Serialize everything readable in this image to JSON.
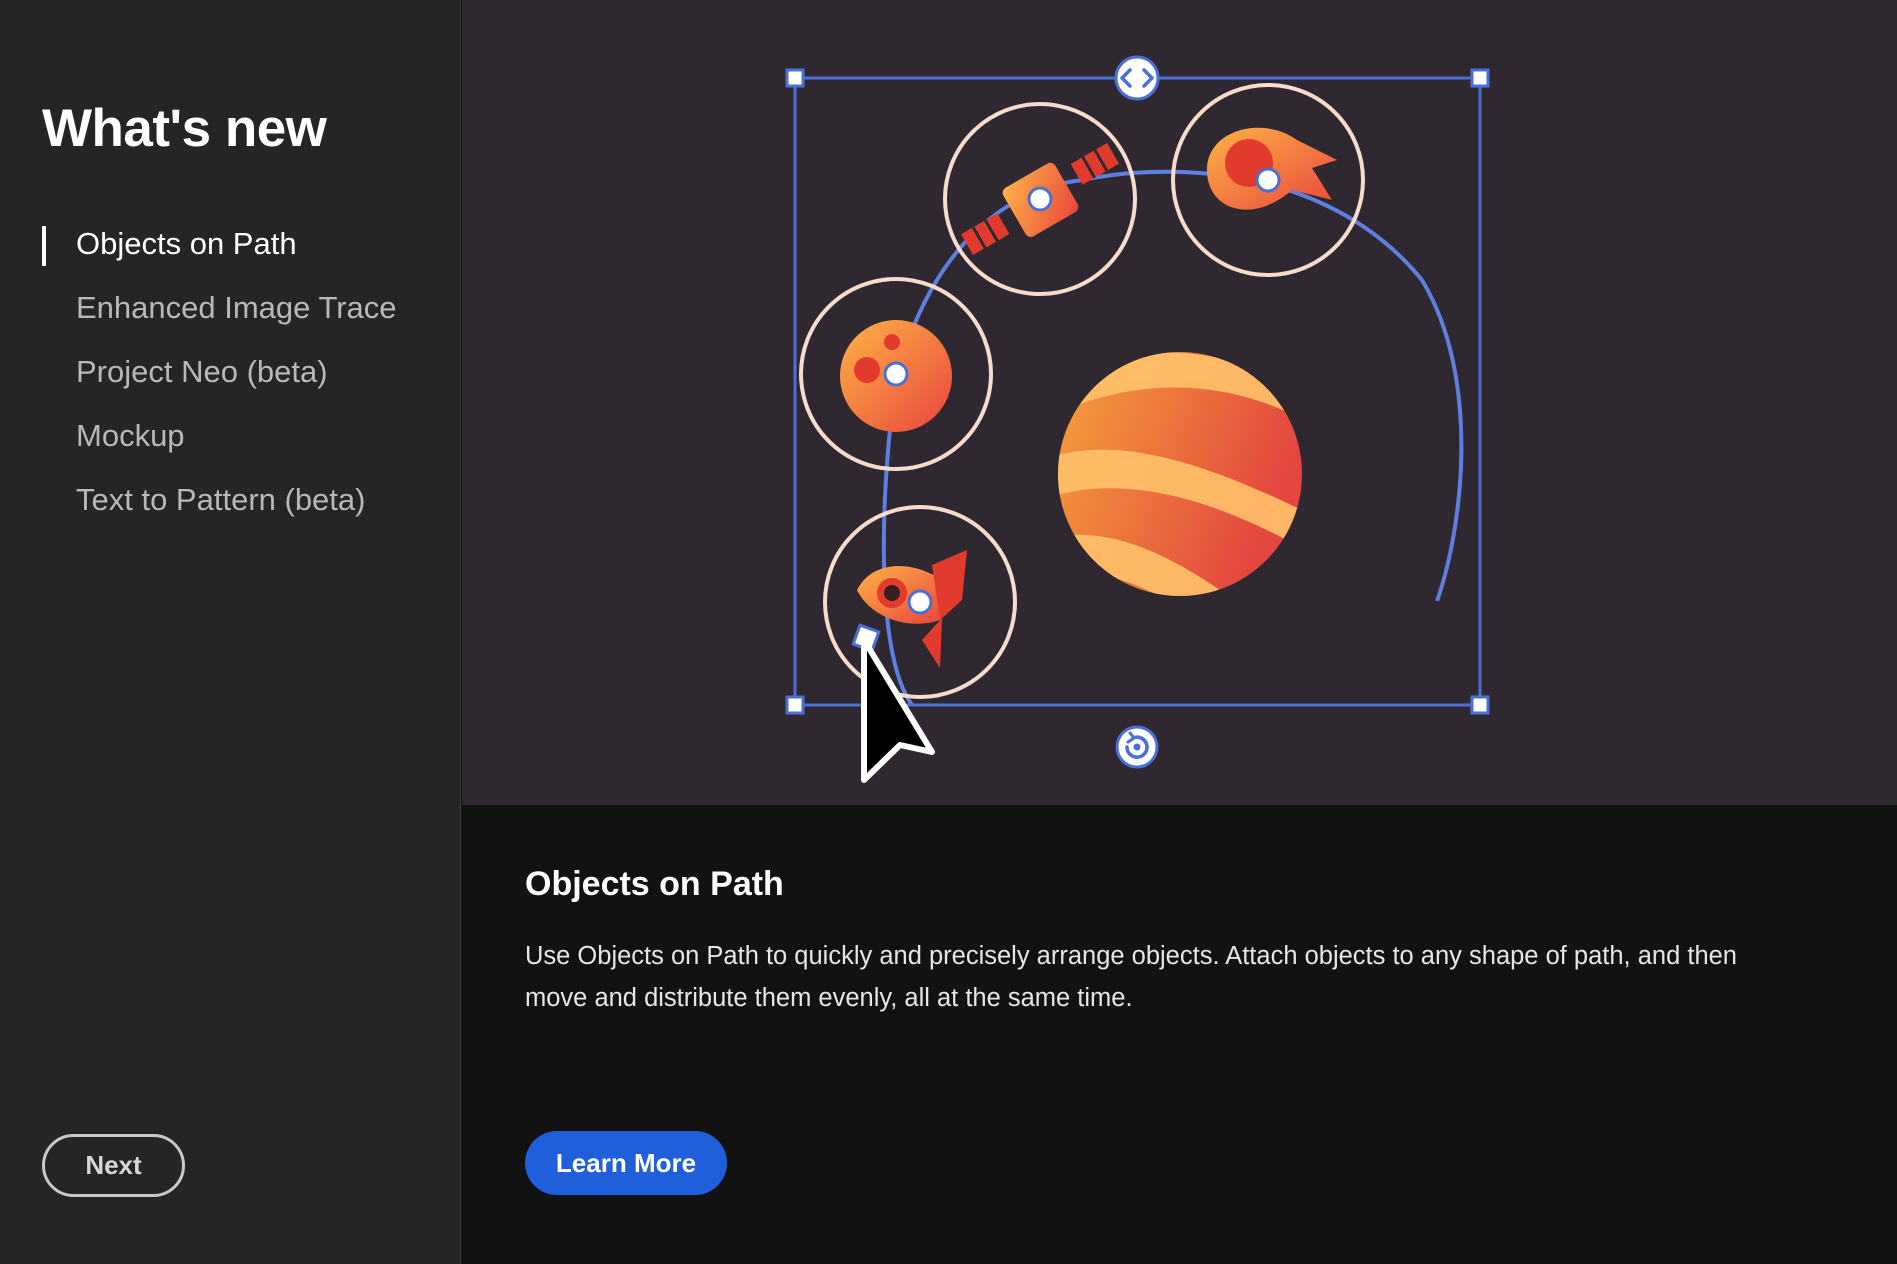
{
  "sidebar": {
    "title": "What's new",
    "items": [
      {
        "label": "Objects on Path",
        "active": true
      },
      {
        "label": "Enhanced Image Trace",
        "active": false
      },
      {
        "label": "Project Neo (beta)",
        "active": false
      },
      {
        "label": "Mockup",
        "active": false
      },
      {
        "label": "Text to Pattern (beta)",
        "active": false
      }
    ],
    "next_label": "Next"
  },
  "hero": {
    "illustration": "objects-on-path-demo",
    "objects": [
      "satellite-icon",
      "comet-icon",
      "planet-icon",
      "rocket-icon",
      "striped-planet"
    ],
    "cursor": "pointer-cursor-icon"
  },
  "content": {
    "title": "Objects on Path",
    "description": "Use Objects on Path to quickly and precisely arrange objects. Attach objects to any shape of path, and then move and distribute them evenly, all at the same time.",
    "learn_more_label": "Learn More"
  },
  "colors": {
    "sidebar_bg": "#252525",
    "hero_bg": "#2f2831",
    "content_bg": "#121212",
    "accent_blue": "#1f5fdc",
    "selection_blue": "#4a6fd6",
    "ring_color": "#f7dccb"
  }
}
